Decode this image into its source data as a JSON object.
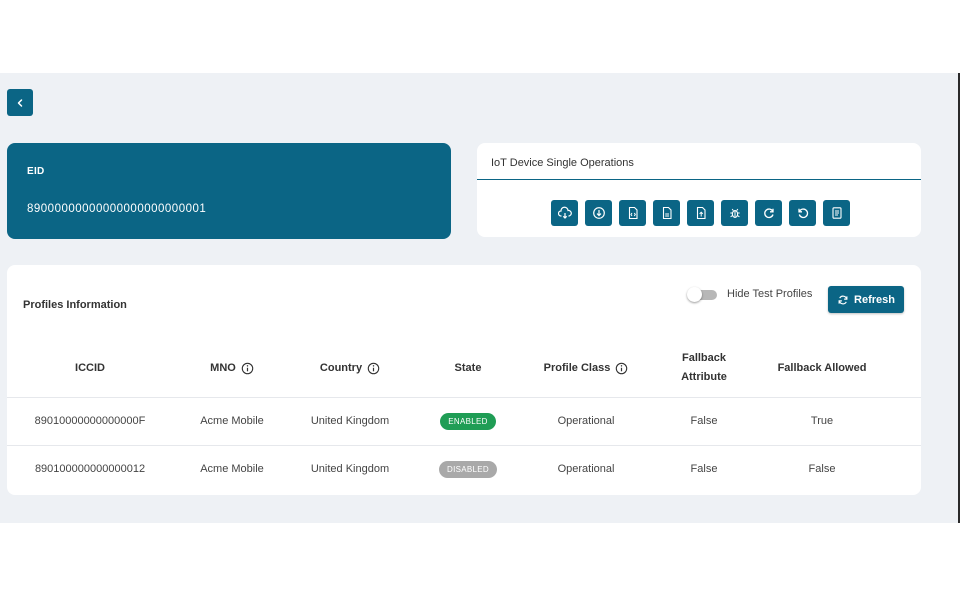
{
  "eid_card": {
    "label": "EID",
    "value": "89000000000000000000000001"
  },
  "operations": {
    "title": "IoT Device Single Operations",
    "buttons": [
      {
        "icon": "cloud-download-icon"
      },
      {
        "icon": "download-circle-icon"
      },
      {
        "icon": "file-code-icon"
      },
      {
        "icon": "file-icon"
      },
      {
        "icon": "file-export-icon"
      },
      {
        "icon": "bug-icon"
      },
      {
        "icon": "refresh-icon"
      },
      {
        "icon": "undo-icon"
      },
      {
        "icon": "list-document-icon"
      }
    ]
  },
  "profiles": {
    "title": "Profiles Information",
    "toggle_label": "Hide Test Profiles",
    "toggle_on": false,
    "refresh_label": "Refresh",
    "columns": {
      "iccid": "ICCID",
      "mno": "MNO",
      "country": "Country",
      "state": "State",
      "profile_class": "Profile Class",
      "fallback_attr_1": "Fallback",
      "fallback_attr_2": "Attribute",
      "fallback_allowed": "Fallback Allowed"
    },
    "rows": [
      {
        "iccid": "89010000000000000F",
        "mno": "Acme Mobile",
        "country": "United Kingdom",
        "state": "ENABLED",
        "state_color": "#1f9d55",
        "profile_class": "Operational",
        "fallback_attribute": "False",
        "fallback_allowed": "True"
      },
      {
        "iccid": "890100000000000012",
        "mno": "Acme Mobile",
        "country": "United Kingdom",
        "state": "DISABLED",
        "state_color": "#a9a9a9",
        "profile_class": "Operational",
        "fallback_attribute": "False",
        "fallback_allowed": "False"
      }
    ]
  },
  "colors": {
    "primary": "#0b6585",
    "background": "#eef1f5",
    "enabled": "#1f9d55",
    "disabled": "#a9a9a9"
  }
}
